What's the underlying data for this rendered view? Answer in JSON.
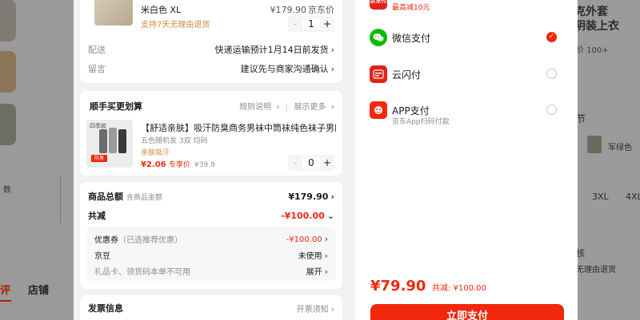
{
  "background_page": {
    "left_tab_active": "评",
    "left_tab": "店铺",
    "left_text": "数",
    "right_title_1": "克外套",
    "right_title_2": "阴装上衣",
    "right_sales": "价 100+",
    "right_pin": "节",
    "right_variant": "军绿色",
    "right_sizes": [
      "3XL",
      "4XL"
    ],
    "right_section": "核",
    "right_return": "无理由退货"
  },
  "order": {
    "product": {
      "variant": "米白色 XL",
      "return_policy": "支持7天无理由退货",
      "price": "¥179.90",
      "price_note": "京东价",
      "quantity": "1",
      "minus": "-",
      "plus": "+"
    },
    "shipping": {
      "label": "配送",
      "value": "快递运输预计1月14日前发货"
    },
    "message": {
      "label": "留言",
      "value": "建议先与商家沟通确认"
    },
    "addon": {
      "title": "顺手买更划算",
      "rules": "规则说明",
      "more": "展示更多",
      "item_title": "【舒适亲肤】吸汗防臭商务男袜中筒袜纯色袜子男四…",
      "item_spec": "五色随机发 3双 均码",
      "item_tag": "亲肤吸汗",
      "item_price": "¥2.06",
      "item_price_tag": "专享价",
      "item_orig": "¥39.9",
      "quantity": "0",
      "img_label": "四季款",
      "img_sub": "防臭",
      "minus": "-",
      "plus": "+"
    },
    "summary": {
      "total_label": "商品总额",
      "total_sub": "含商品金额",
      "total_value": "¥179.90",
      "discount_label": "共减",
      "discount_value": "-¥100.00",
      "coupon_label": "优惠券",
      "coupon_sub": "（已选推荐优惠）",
      "coupon_value": "-¥100.00",
      "jingdou_label": "京豆",
      "jingdou_value": "未使用",
      "gift_label": "礼品卡、领货码本单不可用",
      "gift_value": "展开"
    },
    "invoice": {
      "title": "发票信息",
      "value": "开票须知"
    }
  },
  "payment": {
    "top_option_note": "最高减10元",
    "top_option_icon": "京东付",
    "options": [
      {
        "name": "微信支付",
        "icon": "wechat-pay-icon",
        "selected": true
      },
      {
        "name": "云闪付",
        "icon": "unionpay-icon",
        "selected": false
      },
      {
        "name": "APP支付",
        "sub": "京东App扫码付款",
        "icon": "jd-app-icon",
        "selected": false
      }
    ],
    "checkmark": "✓",
    "total": "¥79.90",
    "saved": "共减: ¥100.00",
    "pay_button": "立即支付"
  },
  "colors": {
    "accent": "#f2270c",
    "wechat": "#09bb07",
    "unionpay": "#e2231a"
  }
}
